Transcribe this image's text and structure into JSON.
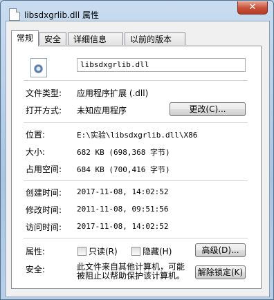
{
  "window": {
    "title": "libsdxgrlib.dll 属性",
    "close_label": "✕"
  },
  "tabs": [
    {
      "label": "常规",
      "active": true
    },
    {
      "label": "安全",
      "active": false
    },
    {
      "label": "详细信息",
      "active": false
    },
    {
      "label": "以前的版本",
      "active": false
    }
  ],
  "file": {
    "name": "libsdxgrlib.dll",
    "icon": "dll-file-icon"
  },
  "general": {
    "type_label": "文件类型:",
    "type_value": "应用程序扩展 (.dll)",
    "open_with_label": "打开方式:",
    "open_with_value": "未知应用程序",
    "change_button": "更改(C)...",
    "location_label": "位置:",
    "location_value": "E:\\实验\\libsdxgrlib.dll\\X86",
    "size_label": "大小:",
    "size_value": "682 KB (698,368 字节)",
    "disk_size_label": "占用空间:",
    "disk_size_value": "684 KB (700,416 字节)",
    "created_label": "创建时间:",
    "created_value": "2017-11-08, 14:02:52",
    "modified_label": "修改时间:",
    "modified_value": "2011-11-08, 09:51:56",
    "accessed_label": "访问时间:",
    "accessed_value": "2017-11-08, 14:02:52",
    "attributes_label": "属性:",
    "readonly_label": "只读(R)",
    "hidden_label": "隐藏(H)",
    "advanced_button": "高级(D)...",
    "security_label": "安全:",
    "security_text_1": "此文件来自其他计算机，可能",
    "security_text_2": "被阻止以帮助保护该计算机。",
    "unblock_button": "解除锁定(K)"
  }
}
